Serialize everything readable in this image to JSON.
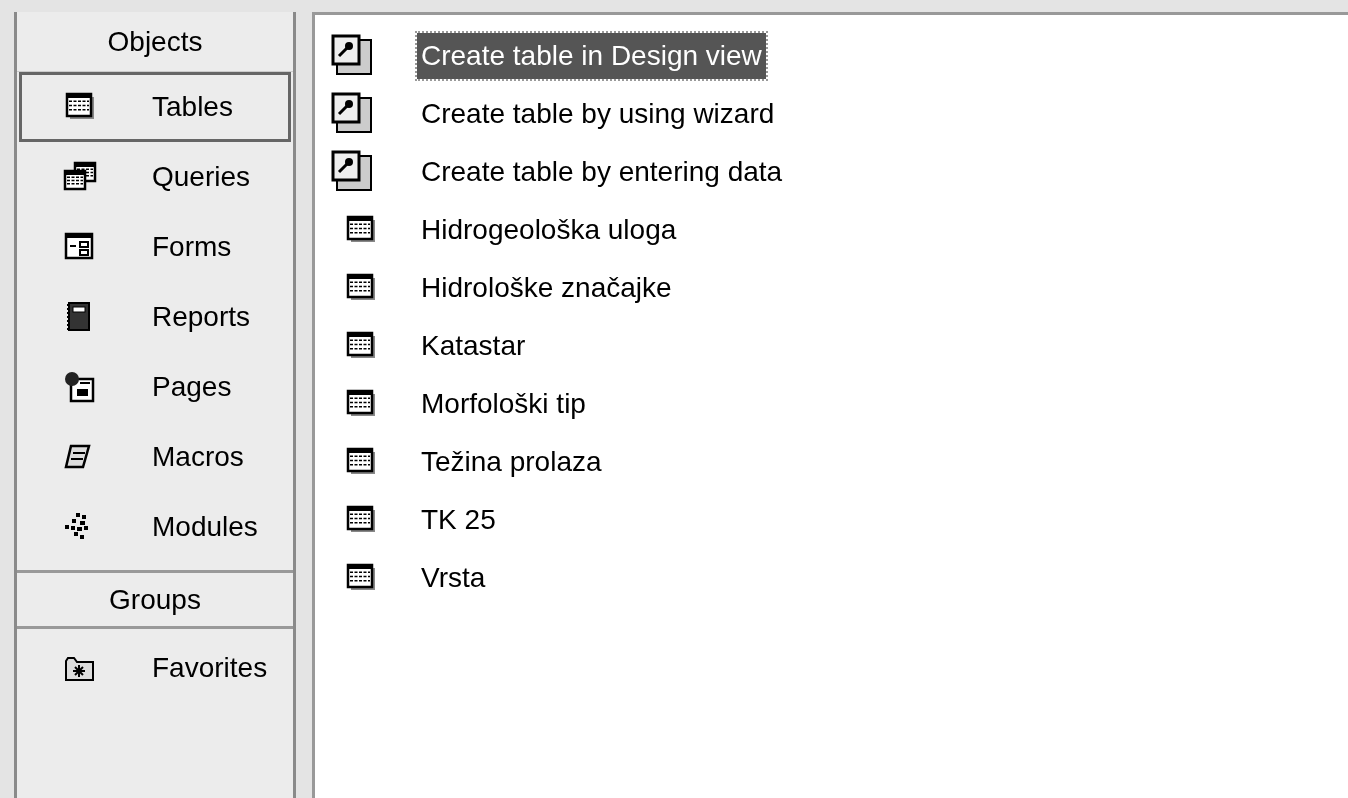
{
  "sidebar": {
    "objects_header": "Objects",
    "items": [
      {
        "label": "Tables",
        "kind": "table",
        "selected": true
      },
      {
        "label": "Queries",
        "kind": "query",
        "selected": false
      },
      {
        "label": "Forms",
        "kind": "form",
        "selected": false
      },
      {
        "label": "Reports",
        "kind": "report",
        "selected": false
      },
      {
        "label": "Pages",
        "kind": "page",
        "selected": false
      },
      {
        "label": "Macros",
        "kind": "macro",
        "selected": false
      },
      {
        "label": "Modules",
        "kind": "module",
        "selected": false
      }
    ],
    "groups_header": "Groups",
    "groups": [
      {
        "label": "Favorites",
        "kind": "favorites",
        "selected": false
      }
    ]
  },
  "list": {
    "items": [
      {
        "label": "Create table in Design view",
        "kind": "shortcut",
        "selected": true
      },
      {
        "label": "Create table by using wizard",
        "kind": "shortcut",
        "selected": false
      },
      {
        "label": "Create table by entering data",
        "kind": "shortcut",
        "selected": false
      },
      {
        "label": "Hidrogeološka uloga",
        "kind": "table",
        "selected": false
      },
      {
        "label": "Hidrološke značajke",
        "kind": "table",
        "selected": false
      },
      {
        "label": "Katastar",
        "kind": "table",
        "selected": false
      },
      {
        "label": "Morfološki tip",
        "kind": "table",
        "selected": false
      },
      {
        "label": "Težina prolaza",
        "kind": "table",
        "selected": false
      },
      {
        "label": "TK 25",
        "kind": "table",
        "selected": false
      },
      {
        "label": "Vrsta",
        "kind": "table",
        "selected": false
      }
    ]
  }
}
